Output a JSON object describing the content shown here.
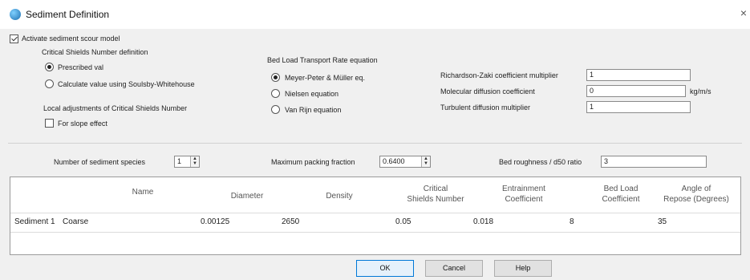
{
  "window": {
    "title": "Sediment Definition",
    "close_glyph": "×"
  },
  "activate": {
    "label": "Activate sediment scour model",
    "checked": true
  },
  "critical_shields": {
    "heading": "Critical Shields Number definition",
    "options": [
      "Prescribed val",
      "Calculate value using Soulsby-Whitehouse"
    ],
    "selected": 0
  },
  "local_adjust": {
    "heading": "Local adjustments of Critical Shields Number",
    "slope_label": "For slope effect",
    "slope_checked": false
  },
  "bed_load": {
    "heading": "Bed Load Transport Rate equation",
    "options": [
      "Meyer-Peter & Müller eq.",
      "Nielsen equation",
      "Van Rijn equation"
    ],
    "selected": 0
  },
  "coefficients": {
    "richardson_label": "Richardson-Zaki coefficient multiplier",
    "richardson_value": "1",
    "molecular_label": "Molecular diffusion coefficient",
    "molecular_value": "0",
    "molecular_unit": "kg/m/s",
    "turbulent_label": "Turbulent diffusion multiplier",
    "turbulent_value": "1"
  },
  "species": {
    "label": "Number of sediment species",
    "value": "1"
  },
  "packing": {
    "label": "Maximum packing fraction",
    "value": "0.6400"
  },
  "roughness": {
    "label": "Bed roughness / d50 ratio",
    "value": "3"
  },
  "table": {
    "headers": {
      "name": "Name",
      "diameter": "Diameter",
      "density": "Density",
      "critical_1": "Critical",
      "critical_2": "Shields Number",
      "entrainment_1": "Entrainment",
      "entrainment_2": "Coefficient",
      "bedload_1": "Bed Load",
      "bedload_2": "Coefficient",
      "angle_1": "Angle of",
      "angle_2": "Repose (Degrees)"
    },
    "row": {
      "label": "Sediment 1",
      "name": "Coarse",
      "diameter": "0.00125",
      "density": "2650",
      "critical": "0.05",
      "entrainment": "0.018",
      "bedload": "8",
      "angle": "35"
    }
  },
  "buttons": {
    "ok": "OK",
    "cancel": "Cancel",
    "help": "Help"
  }
}
